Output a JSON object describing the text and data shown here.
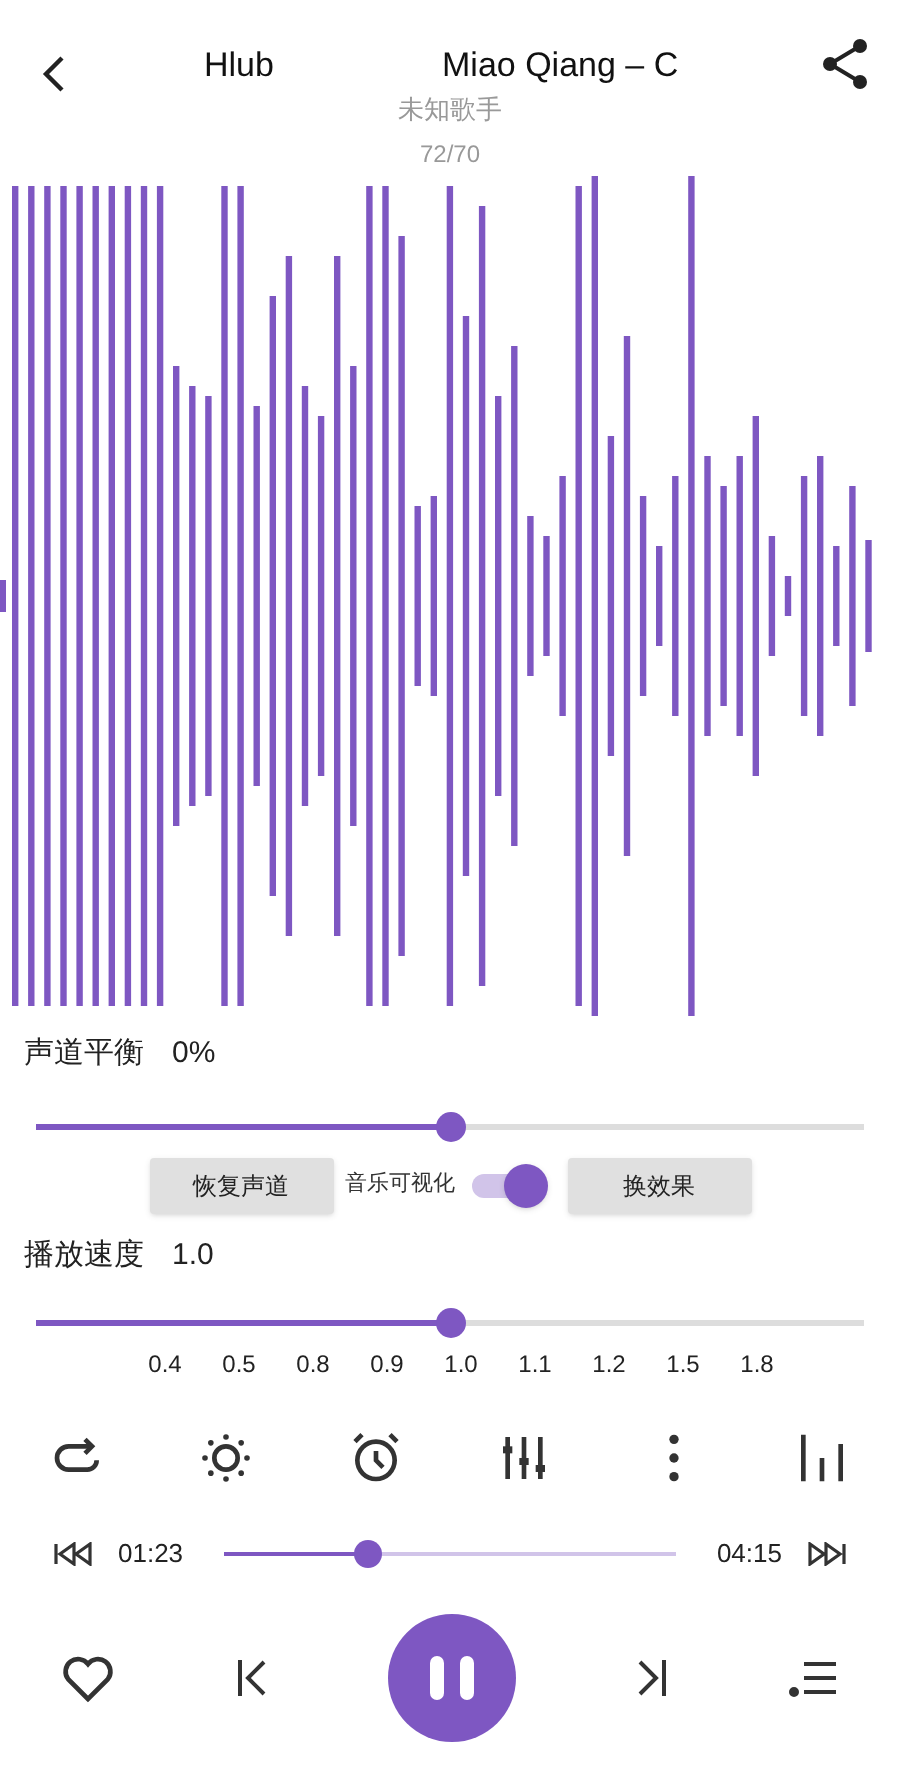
{
  "header": {
    "title_parts": [
      "Hlub",
      "Miao Qiang – C"
    ],
    "artist": "未知歌手",
    "track_counter": "72/70"
  },
  "balance": {
    "label": "声道平衡",
    "value": "0%",
    "level": 0.5
  },
  "effect_row": {
    "restore_button": "恢复声道",
    "visualize_label": "音乐可视化",
    "visualize_on": true,
    "change_button": "换效果"
  },
  "speed": {
    "label": "播放速度",
    "value": "1.0",
    "level": 0.5,
    "ticks": [
      "0.4",
      "0.5",
      "0.8",
      "0.9",
      "1.0",
      "1.1",
      "1.2",
      "1.5",
      "1.8"
    ]
  },
  "progress": {
    "elapsed": "01:23",
    "total": "04:15",
    "level": 0.32
  },
  "player": {
    "playing": true
  }
}
